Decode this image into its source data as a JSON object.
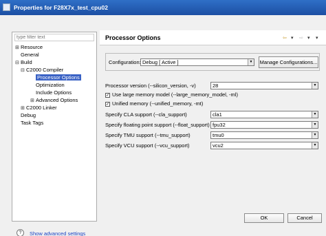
{
  "window": {
    "title": "Properties for F28X7x_test_cpu02"
  },
  "filter": {
    "placeholder": "type filter text"
  },
  "tree": {
    "resource": "Resource",
    "general": "General",
    "build": "Build",
    "c2000_compiler": "C2000 Compiler",
    "processor_options": "Processor Options",
    "optimization": "Optimization",
    "include_options": "Include Options",
    "advanced_options": "Advanced Options",
    "c2000_linker": "C2000 Linker",
    "debug": "Debug",
    "task_tags": "Task Tags"
  },
  "page": {
    "title": "Processor Options"
  },
  "configuration": {
    "label": "Configuration:",
    "value": "Debug  [ Active ]",
    "manage_button": "Manage Configurations..."
  },
  "options": {
    "processor_version": {
      "label": "Processor version (--silicon_version, -v)",
      "value": "28"
    },
    "large_memory": {
      "label": "Use large memory model (--large_memory_model, -ml)",
      "checked": true
    },
    "unified_memory": {
      "label": "Unified memory (--unified_memory, -mt)",
      "checked": true
    },
    "cla_support": {
      "label": "Specify CLA support (--cla_support)",
      "value": "cla1"
    },
    "float_support": {
      "label": "Specify floating point support (--float_support)",
      "value": "fpu32"
    },
    "tmu_support": {
      "label": "Specify TMU support (--tmu_support)",
      "value": "tmu0"
    },
    "vcu_support": {
      "label": "Specify VCU support (--vcu_support)",
      "value": "vcu2"
    }
  },
  "footer": {
    "help_glyph": "?",
    "advanced_link": "Show advanced settings",
    "ok": "OK",
    "cancel": "Cancel"
  },
  "icons": [
    "app-icon",
    "expand-icon",
    "collapse-icon",
    "dropdown-arrow-icon",
    "back-arrow-icon",
    "forward-arrow-icon",
    "help-icon",
    "checkbox-checked-icon"
  ]
}
